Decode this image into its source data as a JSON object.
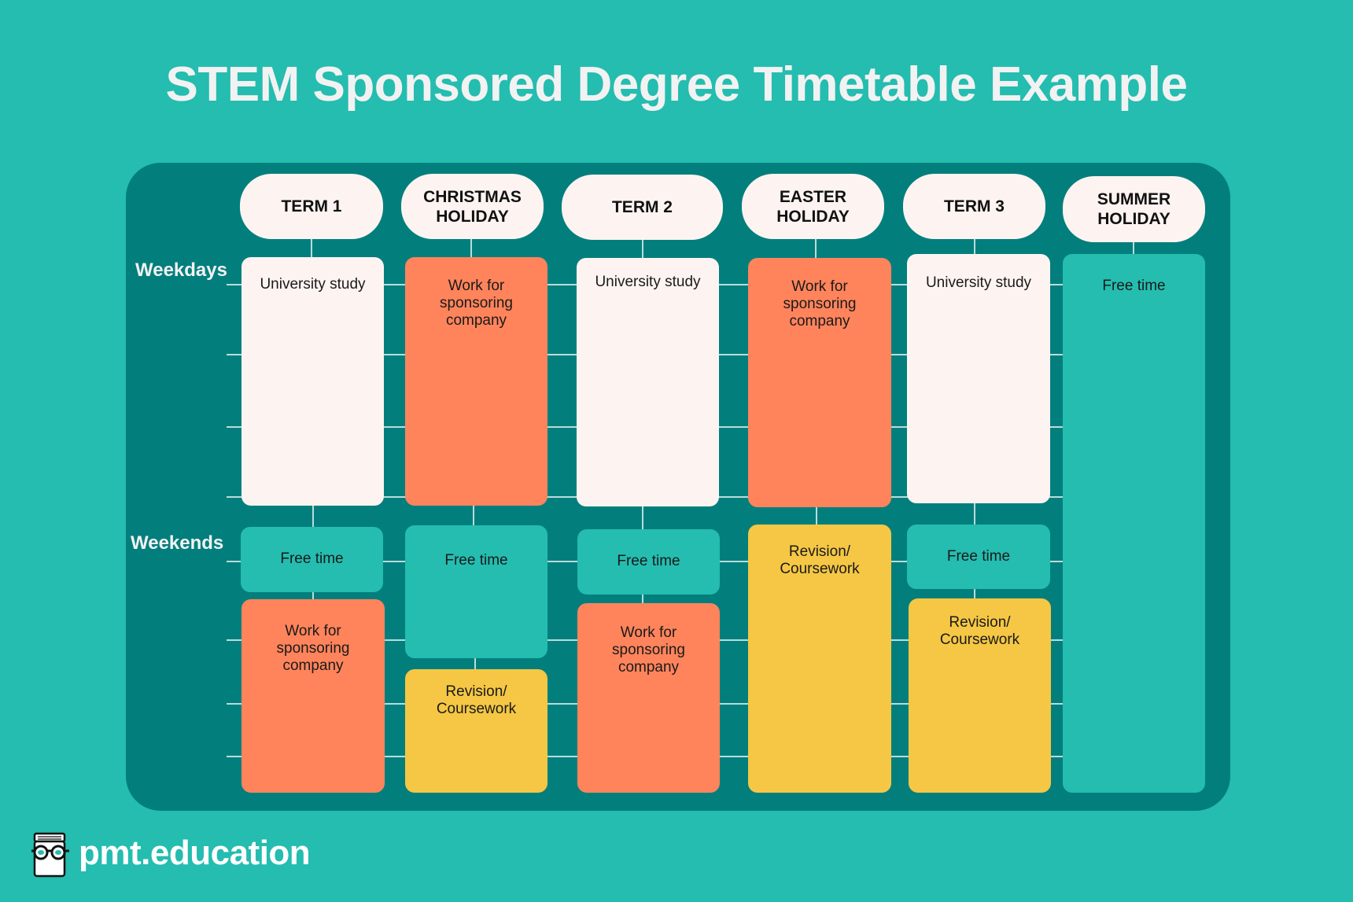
{
  "title": "STEM Sponsored Degree Timetable Example",
  "row_labels": {
    "weekdays": "Weekdays",
    "weekends": "Weekends"
  },
  "columns": [
    {
      "header": "TERM 1",
      "weekday": "University study",
      "weekend": [
        "Free time",
        "Work for sponsoring company"
      ]
    },
    {
      "header": "CHRISTMAS HOLIDAY",
      "weekday": "Work for sponsoring company",
      "weekend": [
        "Free time",
        "Revision/ Coursework"
      ]
    },
    {
      "header": "TERM 2",
      "weekday": "University study",
      "weekend": [
        "Free time",
        "Work for sponsoring company"
      ]
    },
    {
      "header": "EASTER HOLIDAY",
      "weekday": "Work for sponsoring company",
      "weekend": [
        "Revision/ Coursework"
      ]
    },
    {
      "header": "TERM 3",
      "weekday": "University study",
      "weekend": [
        "Free time",
        "Revision/ Coursework"
      ]
    },
    {
      "header": "SUMMER HOLIDAY",
      "all_week": "Free time"
    }
  ],
  "legend_colors": {
    "university_study": "#FDF4F1",
    "work": "#FF845C",
    "free_time": "#24BDB0",
    "revision": "#F5C744"
  },
  "brand": {
    "name": "pmt.education",
    "logo_icon": "book-with-glasses-icon"
  }
}
